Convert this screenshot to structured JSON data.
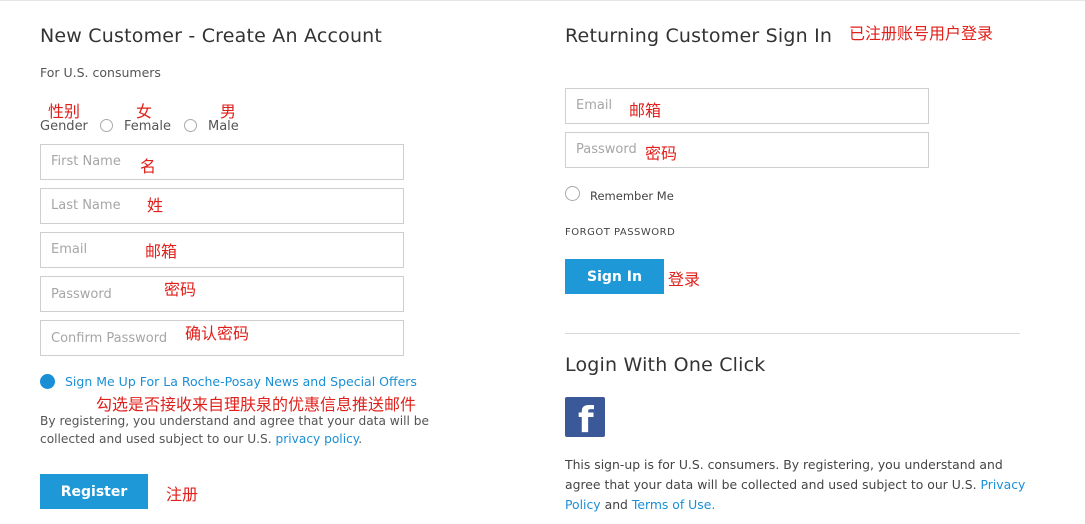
{
  "new_customer": {
    "title": "New Customer - Create An Account",
    "subtitle": "For U.S. consumers",
    "gender_label": "Gender",
    "female_label": "Female",
    "male_label": "Male",
    "first_name_placeholder": "First Name",
    "last_name_placeholder": "Last Name",
    "email_placeholder": "Email",
    "password_placeholder": "Password",
    "confirm_password_placeholder": "Confirm Password",
    "signup_offers_label": "Sign Me Up For La Roche-Posay News and Special Offers",
    "disclaimer_line1": "By registering, you understand and agree that your data will be",
    "disclaimer_line2_pre": "collected and used subject to our U.S.",
    "privacy_link": "privacy policy",
    "disclaimer_line2_post": ".",
    "register_button": "Register"
  },
  "returning_customer": {
    "title": "Returning Customer Sign In",
    "email_placeholder": "Email",
    "password_placeholder": "Password",
    "remember_me": "Remember Me",
    "forgot_password": "FORGOT PASSWORD",
    "sign_in_button": "Sign In"
  },
  "one_click": {
    "title": "Login With One Click",
    "facebook_glyph": "f",
    "note_line1": "This sign-up is for U.S. consumers. By registering, you understand and",
    "note_line2_pre": "agree that your data will be collected and used subject to our U.S.",
    "privacy_policy_link": "Privacy",
    "privacy_policy_link_2": "Policy",
    "and_text": "and",
    "terms_link": "Terms of Use",
    "period": "."
  },
  "annotations": {
    "returning_title": "已注册账号用户登录",
    "gender": "性别",
    "female": "女",
    "male": "男",
    "first_name": "名",
    "last_name": "姓",
    "email_left": "邮箱",
    "password_left": "密码",
    "confirm_password": "确认密码",
    "signup_offers": "勾选是否接收来自理肤泉的优惠信息推送邮件",
    "register": "注册",
    "email_right": "邮箱",
    "password_right": "密码",
    "sign_in": "登录"
  },
  "colors": {
    "accent": "#1f98d8",
    "link": "#1a8fd6",
    "annotation": "#e0201b",
    "facebook": "#3b5998"
  }
}
